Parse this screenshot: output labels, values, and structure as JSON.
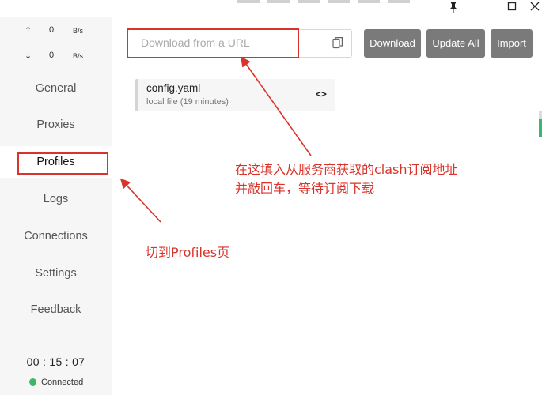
{
  "window": {
    "pin_icon": "pin-icon",
    "maximize_icon": "maximize-icon",
    "close_icon": "close-icon"
  },
  "traffic": {
    "upload": {
      "arrow": "↑",
      "value": "0",
      "unit": "B/s"
    },
    "download": {
      "arrow": "↓",
      "value": "0",
      "unit": "B/s"
    }
  },
  "nav": {
    "items": [
      {
        "label": "General",
        "active": false
      },
      {
        "label": "Proxies",
        "active": false
      },
      {
        "label": "Profiles",
        "active": true
      },
      {
        "label": "Logs",
        "active": false
      },
      {
        "label": "Connections",
        "active": false
      },
      {
        "label": "Settings",
        "active": false
      },
      {
        "label": "Feedback",
        "active": false
      }
    ]
  },
  "status": {
    "uptime": "00 : 15 : 07",
    "connection": "Connected",
    "connection_color": "#3db56d"
  },
  "toolbar": {
    "url_value": "",
    "url_placeholder": "Download from a URL",
    "paste_icon": "paste-icon",
    "download_label": "Download",
    "update_all_label": "Update All",
    "import_label": "Import"
  },
  "profiles": [
    {
      "name": "config.yaml",
      "meta": "local file (19 minutes)",
      "icon": "code-icon"
    }
  ],
  "annotations": {
    "url_hint_line1": "在这填入从服务商获取的clash订阅地址",
    "url_hint_line2": "并敲回车，等待订阅下载",
    "profiles_hint": "切到Profiles页",
    "color": "#d9342b"
  }
}
